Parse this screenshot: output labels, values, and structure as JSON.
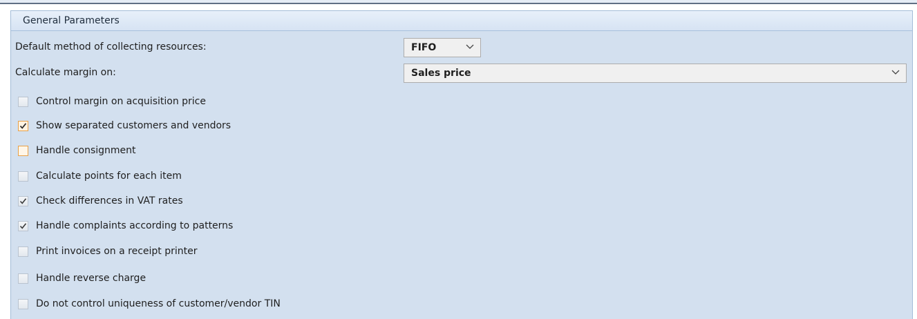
{
  "panel": {
    "title": "General Parameters"
  },
  "fields": {
    "collecting_method": {
      "label": "Default method of collecting resources:",
      "value": "FIFO"
    },
    "margin_base": {
      "label": "Calculate margin on:",
      "value": "Sales price"
    }
  },
  "checkboxes": [
    {
      "label": "Control margin on acquisition price",
      "checked": false,
      "enabled": false
    },
    {
      "label": "Show separated customers and vendors",
      "checked": true,
      "enabled": true,
      "highlighted": true
    },
    {
      "label": "Handle consignment",
      "checked": false,
      "enabled": true,
      "highlighted": true
    },
    {
      "label": "Calculate points for each item",
      "checked": false,
      "enabled": false
    },
    {
      "label": "Check differences in VAT rates",
      "checked": true,
      "enabled": false
    },
    {
      "label": "Handle complaints according to patterns",
      "checked": true,
      "enabled": false
    },
    {
      "label": "Print invoices on a receipt printer",
      "checked": false,
      "enabled": false
    },
    {
      "label": "Handle reverse charge",
      "checked": false,
      "enabled": false
    },
    {
      "label": "Do not control uniqueness of customer/vendor TIN",
      "checked": false,
      "enabled": false
    }
  ],
  "colors": {
    "panel_bg": "#d3e0ef",
    "highlight_border": "#e8a046"
  },
  "icons": {
    "dropdown": "chevron-down-icon",
    "check": "checkmark-icon"
  }
}
